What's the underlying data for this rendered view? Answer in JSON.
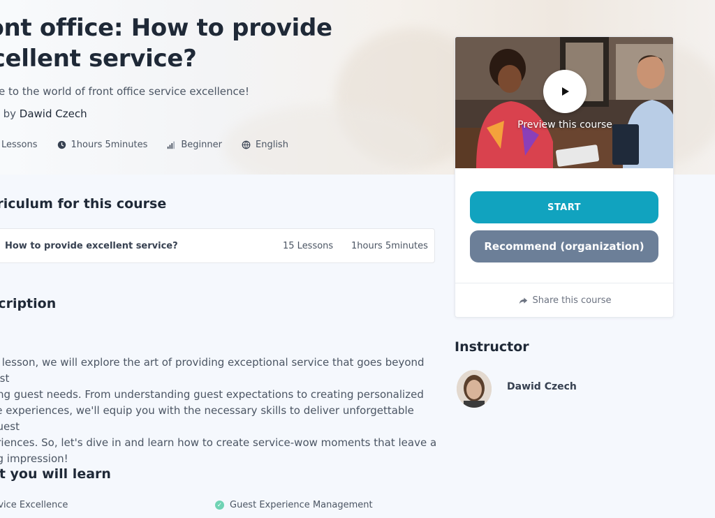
{
  "hero": {
    "title_line1": "ront office: How to provide",
    "title_line2": "xcellent service?",
    "subtitle": "come to the world of front office service excellence!",
    "created_prefix": "ated by",
    "author": "Dawid Czech",
    "meta": {
      "lessons": "Lessons",
      "duration": "1hours 5minutes",
      "level": "Beginner",
      "language": "English"
    }
  },
  "curriculum": {
    "heading": "rriculum for this course",
    "item": {
      "title": "How to provide excellent service?",
      "lessons": "15 Lessons",
      "duration": "1hours 5minutes"
    }
  },
  "description": {
    "heading": "scription",
    "lines": [
      "is lesson, we will explore the art of providing exceptional service that goes beyond just",
      "ting guest needs. From understanding guest expectations to creating personalized",
      "ce experiences, we'll equip you with the necessary skills to deliver unforgettable guest",
      "eriences. So, let's dive in and learn how to create service-wow moments that leave a",
      "ng impression!"
    ]
  },
  "learn": {
    "heading": "at you will learn",
    "items": [
      "rvice Excellence",
      "Guest Experience Management"
    ]
  },
  "card": {
    "preview_label": "Preview this course",
    "start_label": "START",
    "recommend_label": "Recommend (organization)",
    "share_label": "Share this course"
  },
  "instructor": {
    "heading": "Instructor",
    "name": "Dawid Czech"
  },
  "colors": {
    "start": "#11a3bf",
    "recommend": "#6c7f98",
    "check": "#6fd3b4",
    "page_bg": "#f5f8fd"
  }
}
